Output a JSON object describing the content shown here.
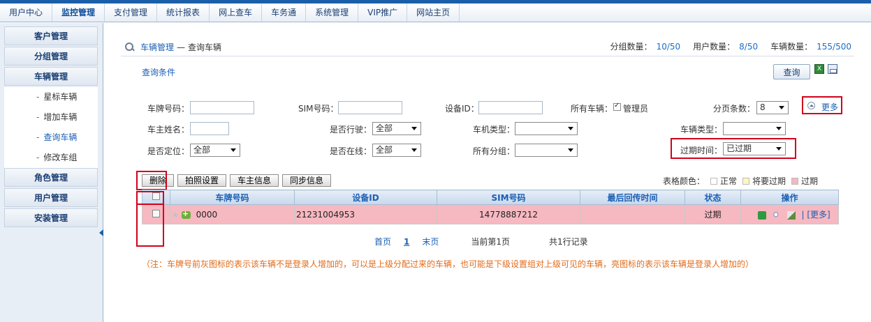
{
  "nav": {
    "items": [
      "用户中心",
      "监控管理",
      "支付管理",
      "统计报表",
      "网上查车",
      "车务通",
      "系统管理",
      "VIP推广",
      "网站主页"
    ],
    "active": 1
  },
  "sidebar": {
    "groups": {
      "customer": "客户管理",
      "group": "分组管理",
      "vehicle": "车辆管理",
      "role": "角色管理",
      "user": "用户管理",
      "install": "安装管理"
    },
    "vehicle_subs": [
      "星标车辆",
      "增加车辆",
      "查询车辆",
      "修改车组"
    ],
    "dash": "-"
  },
  "breadcrumb": {
    "link": "车辆管理",
    "sep": "—",
    "current": "查询车辆"
  },
  "stats": {
    "group_label": "分组数量：",
    "group_value": "10/50",
    "user_label": "用户数量：",
    "user_value": "8/50",
    "vehicle_label": "车辆数量：",
    "vehicle_value": "155/500"
  },
  "query": {
    "title": "查询条件",
    "button": "查询",
    "excel_icon_text": "X",
    "more": "更多",
    "fields": {
      "plate_label": "车牌号码：",
      "plate_value": "",
      "sim_label": "SIM号码：",
      "sim_value": "",
      "device_label": "设备ID：",
      "device_value": "",
      "all_vehicles_label": "所有车辆：",
      "admin_label": "管理员",
      "admin_checked": true,
      "page_size_label": "分页条数：",
      "page_size_value": "8",
      "owner_label": "车主姓名：",
      "owner_value": "",
      "driving_label": "是否行驶：",
      "driving_value": "全部",
      "model_label": "车机类型：",
      "model_value": "",
      "vtype_label": "车辆类型：",
      "vtype_value": "",
      "located_label": "是否定位：",
      "located_value": "全部",
      "online_label": "是否在线：",
      "online_value": "全部",
      "allgroup_label": "所有分组：",
      "allgroup_value": "",
      "expire_label": "过期时间：",
      "expire_value": "已过期"
    }
  },
  "toolbar": {
    "delete": "删除",
    "photo": "拍照设置",
    "owner_info": "车主信息",
    "sync": "同步信息"
  },
  "legend": {
    "label": "表格颜色：",
    "normal": "正常",
    "expiring": "将要过期",
    "expired": "过期",
    "colors": {
      "normal": "#ffffff",
      "expiring": "#fff6c2",
      "expired": "#f6b8c1"
    }
  },
  "table": {
    "headers": [
      "车牌号码",
      "设备ID",
      "SIM号码",
      "最后回传时间",
      "状态",
      "操作"
    ],
    "rows": [
      {
        "star": "★",
        "plate": "0000",
        "device_id": "21231004953",
        "sim": "14778887212",
        "last_time": "",
        "status": "过期",
        "more": "[更多]",
        "sep": "|"
      }
    ]
  },
  "pager": {
    "first": "首页",
    "current_page": "1",
    "last": "末页",
    "info": "当前第1页",
    "total": "共1行记录"
  },
  "note": "（注：车牌号前灰图标的表示该车辆不是登录人增加的，可以是上级分配过来的车辆，也可能是下级设置组对上级可见的车辆，亮图标的表示该车辆是登录人增加的）"
}
